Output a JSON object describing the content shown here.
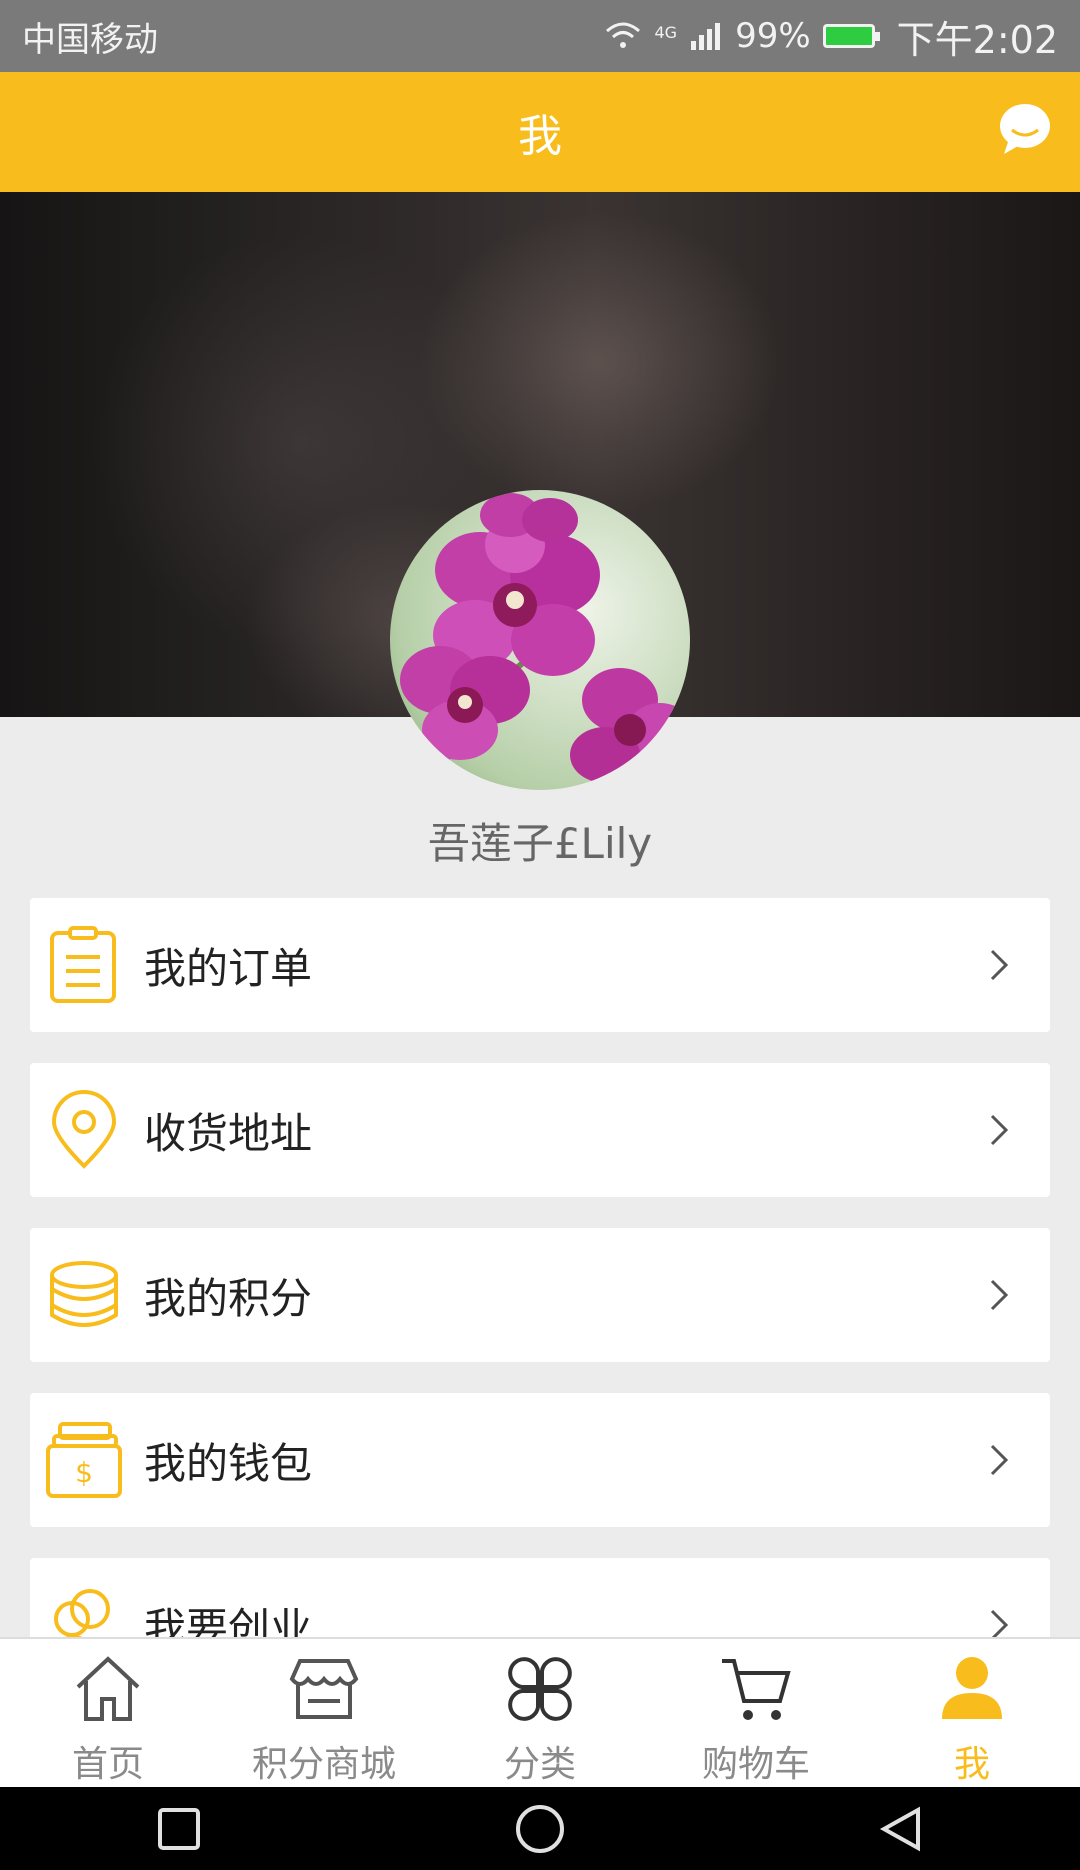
{
  "status_bar": {
    "carrier": "中国移动",
    "network": "4G",
    "battery": "99%",
    "time": "下午2:02"
  },
  "header": {
    "title": "我",
    "message_icon": "chat-bubble-icon"
  },
  "profile": {
    "username": "吾莲子£Lily"
  },
  "menu": {
    "items": [
      {
        "label": "我的订单",
        "icon": "clipboard-icon"
      },
      {
        "label": "收货地址",
        "icon": "location-pin-icon"
      },
      {
        "label": "我的积分",
        "icon": "coins-stack-icon"
      },
      {
        "label": "我的钱包",
        "icon": "wallet-icon"
      },
      {
        "label": "我要创业",
        "icon": "users-icon"
      }
    ]
  },
  "tabbar": {
    "items": [
      {
        "label": "首页",
        "icon": "home-icon"
      },
      {
        "label": "积分商城",
        "icon": "store-icon"
      },
      {
        "label": "分类",
        "icon": "category-icon"
      },
      {
        "label": "购物车",
        "icon": "cart-icon"
      },
      {
        "label": "我",
        "icon": "person-icon",
        "active": true
      }
    ]
  },
  "colors": {
    "accent": "#f8bd1c",
    "status_bar": "#7a7a7a",
    "background": "#ececec"
  }
}
